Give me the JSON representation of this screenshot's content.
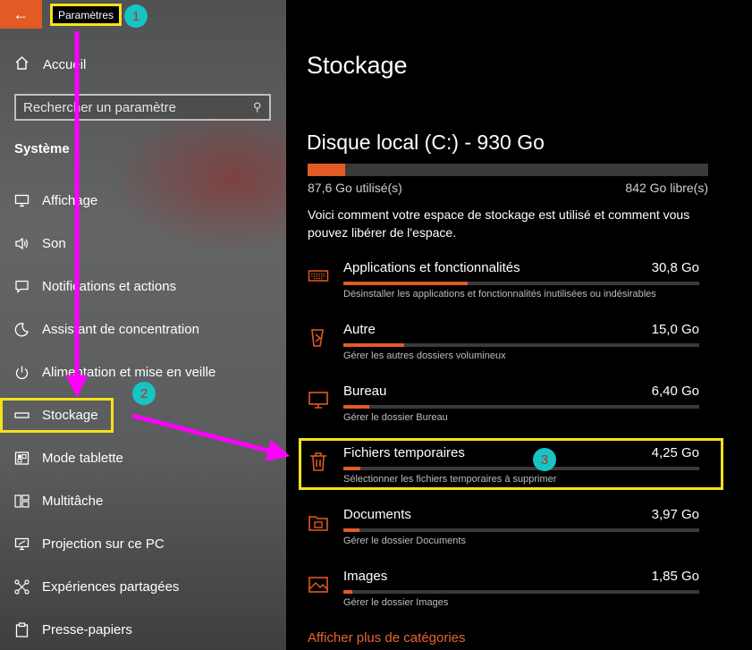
{
  "window": {
    "title": "Paramètres"
  },
  "sidebar": {
    "home_label": "Accueil",
    "search_placeholder": "Rechercher un paramètre",
    "section_label": "Système",
    "items": [
      {
        "label": "Affichage",
        "icon": "monitor-icon"
      },
      {
        "label": "Son",
        "icon": "speaker-icon"
      },
      {
        "label": "Notifications et actions",
        "icon": "message-icon"
      },
      {
        "label": "Assistant de concentration",
        "icon": "moon-icon"
      },
      {
        "label": "Alimentation et mise en veille",
        "icon": "power-icon"
      },
      {
        "label": "Stockage",
        "icon": "storage-icon"
      },
      {
        "label": "Mode tablette",
        "icon": "tablet-icon"
      },
      {
        "label": "Multitâche",
        "icon": "multitask-icon"
      },
      {
        "label": "Projection sur ce PC",
        "icon": "projection-icon"
      },
      {
        "label": "Expériences partagées",
        "icon": "share-icon"
      },
      {
        "label": "Presse-papiers",
        "icon": "clipboard-icon"
      }
    ]
  },
  "main": {
    "title": "Stockage",
    "drive": {
      "name": "Disque local (C:) - 930 Go",
      "used_label": "87,6 Go utilisé(s)",
      "free_label": "842 Go libre(s)",
      "used_fraction": 0.094
    },
    "description": "Voici comment votre espace de stockage est utilisé et comment vous pouvez libérer de l'espace.",
    "categories": [
      {
        "name": "Applications et fonctionnalités",
        "size": "30,8 Go",
        "subtitle": "Désinstaller les applications et fonctionnalités inutilisées ou indésirables",
        "fraction": 0.35,
        "icon": "keyboard-icon"
      },
      {
        "name": "Autre",
        "size": "15,0 Go",
        "subtitle": "Gérer les autres dossiers volumineux",
        "fraction": 0.17,
        "icon": "other-icon"
      },
      {
        "name": "Bureau",
        "size": "6,40 Go",
        "subtitle": "Gérer le dossier Bureau",
        "fraction": 0.073,
        "icon": "desktop-icon"
      },
      {
        "name": "Fichiers temporaires",
        "size": "4,25 Go",
        "subtitle": "Sélectionner les fichiers temporaires à supprimer",
        "fraction": 0.048,
        "icon": "trash-icon"
      },
      {
        "name": "Documents",
        "size": "3,97 Go",
        "subtitle": "Gérer le dossier Documents",
        "fraction": 0.045,
        "icon": "documents-icon"
      },
      {
        "name": "Images",
        "size": "1,85 Go",
        "subtitle": "Gérer le dossier Images",
        "fraction": 0.025,
        "icon": "images-icon"
      }
    ],
    "more_link": "Afficher plus de catégories"
  },
  "annotations": {
    "badge_1": "1",
    "badge_2": "2",
    "badge_3": "3"
  },
  "colors": {
    "accent": "#e25a24",
    "highlight": "#f6e21b",
    "badge": "#16c4c4",
    "badge_text": "#c22a1a",
    "arrow": "#ff00ff"
  }
}
